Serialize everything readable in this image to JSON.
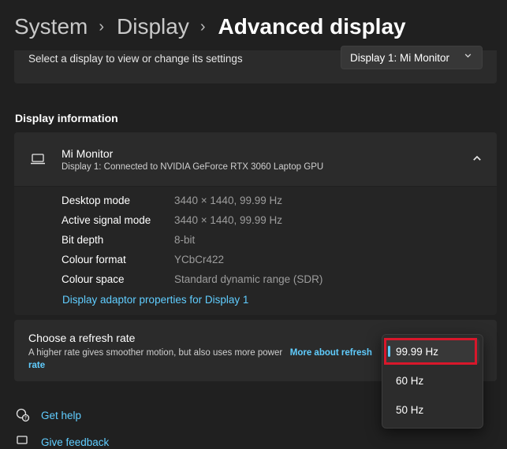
{
  "breadcrumb": {
    "items": [
      "System",
      "Display"
    ],
    "current": "Advanced display"
  },
  "display_select": {
    "label": "Select a display to view or change its settings",
    "selected": "Display 1: Mi Monitor"
  },
  "display_info": {
    "section_title": "Display information",
    "monitor_name": "Mi Monitor",
    "monitor_description": "Display 1: Connected to NVIDIA GeForce RTX 3060 Laptop GPU",
    "rows": [
      {
        "key": "Desktop mode",
        "value": "3440 × 1440, 99.99 Hz"
      },
      {
        "key": "Active signal mode",
        "value": "3440 × 1440, 99.99 Hz"
      },
      {
        "key": "Bit depth",
        "value": "8-bit"
      },
      {
        "key": "Colour format",
        "value": "YCbCr422"
      },
      {
        "key": "Colour space",
        "value": "Standard dynamic range (SDR)"
      }
    ],
    "adapter_link": "Display adaptor properties for Display 1"
  },
  "refresh_rate": {
    "title": "Choose a refresh rate",
    "description": "A higher rate gives smoother motion, but also uses more power",
    "more_link": "More about refresh rate",
    "options": [
      "99.99 Hz",
      "60 Hz",
      "50 Hz"
    ],
    "selected": "99.99 Hz"
  },
  "footer": {
    "help": "Get help",
    "feedback": "Give feedback"
  },
  "colors": {
    "background": "#202020",
    "card": "#2b2b2b",
    "accent": "#60cdff",
    "highlight": "#d8172b"
  },
  "icons": {
    "breadcrumb_separator": "chevron-right-icon",
    "dropdown": "chevron-down-icon",
    "monitor": "laptop-icon",
    "collapse": "chevron-up-icon",
    "help": "help-icon",
    "feedback": "feedback-icon"
  }
}
